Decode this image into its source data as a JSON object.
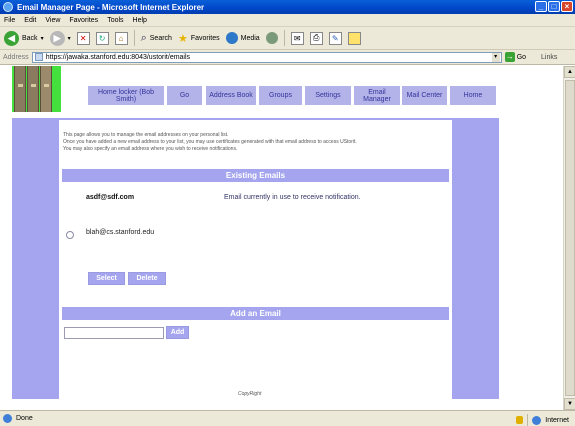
{
  "window": {
    "title": "Email Manager Page - Microsoft Internet Explorer"
  },
  "menu": [
    "File",
    "Edit",
    "View",
    "Favorites",
    "Tools",
    "Help"
  ],
  "toolbar": {
    "back": "Back",
    "search": "Search",
    "favorites": "Favorites",
    "media": "Media"
  },
  "address": {
    "label": "Address",
    "url": "https://jawaka.stanford.edu:8043/ustorit/emails",
    "go": "Go",
    "links": "Links"
  },
  "nav": [
    {
      "label": "Home locker (Bob Smith)"
    },
    {
      "label": "Go"
    },
    {
      "label": "Address Book"
    },
    {
      "label": "Groups"
    },
    {
      "label": "Settings"
    },
    {
      "label": "Email Manager"
    },
    {
      "label": "Mail Center"
    },
    {
      "label": "Home"
    }
  ],
  "intro": [
    "This page allows you to manage the email addresses on your personal list.",
    "Once you have added a new email address to your list, you may use certificates generated with that email address to access UStorit.",
    "You may also specify an email address where you wish to receive notifications."
  ],
  "existing": {
    "heading": "Existing Emails",
    "primary_email": "asdf@sdf.com",
    "primary_note": "Email currently in use to receive notification.",
    "other_email": "blah@cs.stanford.edu",
    "select_label": "Select",
    "delete_label": "Delete"
  },
  "add": {
    "heading": "Add an Email",
    "input_value": "",
    "button_label": "Add"
  },
  "footer": {
    "copyright": "CopyRight"
  },
  "status": {
    "left": "Done",
    "zone": "Internet"
  },
  "colors": {
    "accent": "#a5a5ef",
    "nav_bg": "#b3b3ea",
    "nav_text": "#333399",
    "logo_bg": "#44e03e"
  }
}
